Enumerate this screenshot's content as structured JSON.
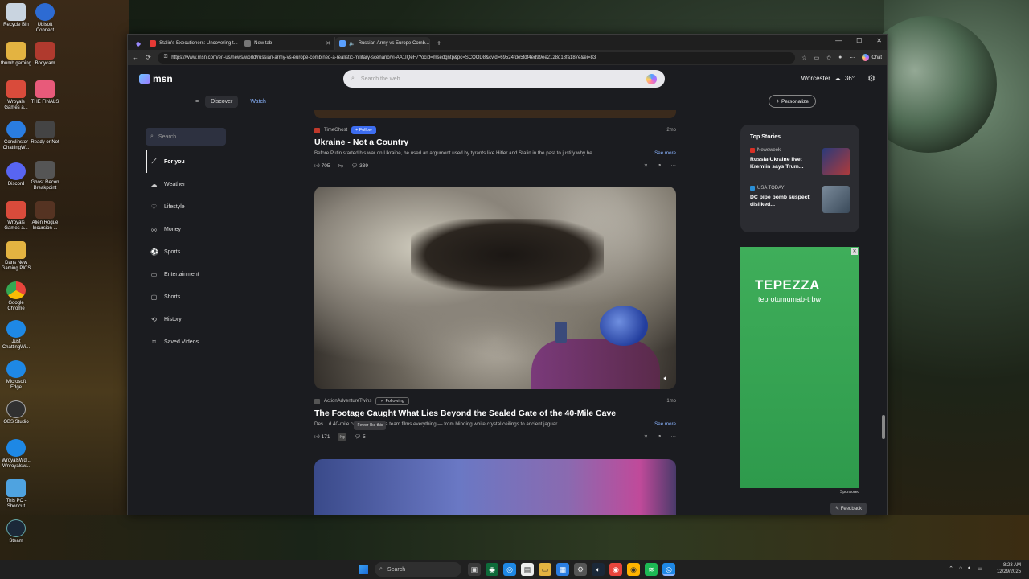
{
  "desktop": {
    "icons": [
      {
        "label": "Recycle Bin",
        "color": "#c9d4e0"
      },
      {
        "label": "thumb gaming",
        "color": "#e3b341"
      },
      {
        "label": "Wroyals Games a...",
        "color": "#d94b3b"
      },
      {
        "label": "Conclinstor ChattingW...",
        "color": "#2a7de1"
      },
      {
        "label": "Discord",
        "color": "#5865f2"
      },
      {
        "label": "Wroyals Games a...",
        "color": "#d94b3b"
      },
      {
        "label": "Dans New Gaming PICS",
        "color": "#e3b341"
      },
      {
        "label": "Google Chrome",
        "color": "#e8453c"
      },
      {
        "label": "Just ChattingWi...",
        "color": "#1e88e5"
      },
      {
        "label": "Microsoft Edge",
        "color": "#1e88e5"
      },
      {
        "label": "OBS Studio",
        "color": "#303030"
      },
      {
        "label": "WroyalsWd... Wnroyalsw...",
        "color": "#1e88e5"
      },
      {
        "label": "This PC - Shortcut",
        "color": "#4fa3e0"
      },
      {
        "label": "Steam",
        "color": "#1b2838"
      }
    ],
    "icons_col2": [
      {
        "label": "Ubisoft Connect",
        "color": "#2d6bd3"
      },
      {
        "label": "Bodycam",
        "color": "#b03a2e"
      },
      {
        "label": "THE FINALS",
        "color": "#e85a7a"
      },
      {
        "label": "Ready or Not",
        "color": "#444"
      },
      {
        "label": "Ghost Recon Breakpoint",
        "color": "#555"
      },
      {
        "label": "Alien Rogue Incursion ...",
        "color": "#553322"
      }
    ]
  },
  "browser": {
    "tabs": [
      {
        "label": "Stalin's Executioners: Uncovering t...",
        "icon_color": "#e53935"
      },
      {
        "label": "New tab",
        "icon_color": "#777"
      },
      {
        "label": "Russian Army vs Europe Comb...",
        "icon_color": "#5aa0ff"
      }
    ],
    "url": "https://www.msn.com/en-us/news/world/russian-army-vs-europe-combined-a-realistic-military-scenario/vi-AA1IQeF7?ocid=msedgntp&pc=SCOOD8&cvid=69524fde5fdf4ed99ee2128d18fa187e&ei=83",
    "chat_label": "Chat"
  },
  "msn": {
    "logo": "msn",
    "search_placeholder": "Search the web",
    "location": "Worcester",
    "temperature": "36°",
    "nav": {
      "discover": "Discover",
      "watch": "Watch"
    },
    "personalize": "Personalize",
    "sidebar_search": "Search",
    "sidebar": [
      {
        "label": "For you",
        "icon": "⟋"
      },
      {
        "label": "Weather",
        "icon": "☁"
      },
      {
        "label": "Lifestyle",
        "icon": "♡"
      },
      {
        "label": "Money",
        "icon": "◎"
      },
      {
        "label": "Sports",
        "icon": "⚽"
      },
      {
        "label": "Entertainment",
        "icon": "▭"
      },
      {
        "label": "Shorts",
        "icon": "▢"
      },
      {
        "label": "History",
        "icon": "⟲"
      },
      {
        "label": "Saved Videos",
        "icon": "⌑"
      }
    ],
    "card1": {
      "source": "TimeGhost",
      "follow": "Follow",
      "age": "2mo",
      "headline": "Ukraine - Not a Country",
      "excerpt": "Before Putin started his war on Ukraine, he used an argument used by tyrants like Hitler and Stalin in the past to justify why he...",
      "see_more": "See more",
      "likes": "705",
      "comments": "339"
    },
    "card2": {
      "source": "ActionAdventureTwins",
      "following": "Following",
      "age": "1mo",
      "headline": "The Footage Caught What Lies Beyond the Sealed Gate of the 40-Mile Cave",
      "excerpt": "Des... d 40-mile cave system, the team films everything — from blinding white crystal ceilings to ancient jaguar...",
      "see_more": "See more",
      "likes": "171",
      "comments": "5",
      "tooltip": "Fewer like this"
    },
    "top_stories": {
      "title": "Top Stories",
      "items": [
        {
          "source": "Newsweek",
          "headline": "Russia-Ukraine live: Kremlin says Trum...",
          "src_color": "#d93025",
          "thumb": "#2a3a7a"
        },
        {
          "source": "USA TODAY",
          "headline": "DC pipe bomb suspect disliked...",
          "src_color": "#2a8fd6",
          "thumb": "#7a8a9a"
        }
      ]
    },
    "ad": {
      "brand": "TEPEZZA",
      "sub": "teprotumumab-trbw",
      "sponsored": "Sponsored"
    },
    "feedback": "Feedback"
  },
  "taskbar": {
    "search": "Search",
    "time": "8:23 AM",
    "date": "12/29/2025"
  }
}
